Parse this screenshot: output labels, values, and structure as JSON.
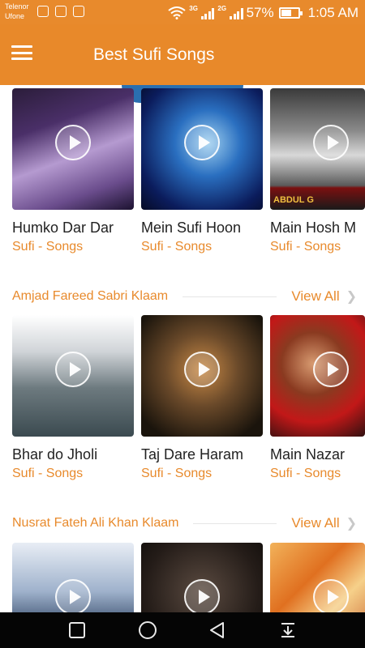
{
  "status_bar": {
    "carrier1": "Telenor",
    "carrier2": "Ufone",
    "network1": "3G",
    "network2": "2G",
    "battery": "57%",
    "time": "1:05 AM"
  },
  "app_bar": {
    "title": "Best Sufi Songs",
    "menu_icon": "hamburger-menu-icon"
  },
  "colors": {
    "accent": "#e88a2c",
    "tab_blue": "#2a6fb0",
    "nav_bg": "#050505"
  },
  "sections": [
    {
      "title": "",
      "items": [
        {
          "title": "Humko Dar Dar",
          "subtitle": "Sufi - Songs"
        },
        {
          "title": "Mein Sufi Hoon",
          "subtitle": "Sufi - Songs"
        },
        {
          "title": "Main Hosh M",
          "subtitle": "Sufi - Songs",
          "thumb_text": "ABDUL G"
        }
      ]
    },
    {
      "title": "Amjad Fareed Sabri Klaam",
      "view_all": "View All",
      "items": [
        {
          "title": "Bhar do Jholi",
          "subtitle": "Sufi - Songs"
        },
        {
          "title": "Taj Dare Haram",
          "subtitle": "Sufi - Songs"
        },
        {
          "title": "Main Nazar",
          "subtitle": "Sufi - Songs"
        }
      ]
    },
    {
      "title": "Nusrat Fateh Ali Khan Klaam",
      "view_all": "View All",
      "items": [
        {
          "title": "",
          "subtitle": ""
        },
        {
          "title": "",
          "subtitle": ""
        },
        {
          "title": "",
          "subtitle": ""
        }
      ]
    }
  ],
  "nav_bar": [
    "square-recents-icon",
    "circle-home-icon",
    "triangle-back-icon",
    "notification-pull-icon"
  ]
}
